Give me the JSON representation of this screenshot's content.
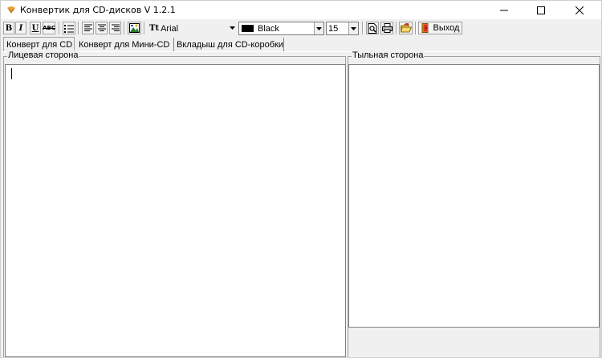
{
  "window": {
    "title": "Конвертик для CD-дисков V 1.2.1"
  },
  "toolbar": {
    "bold_label": "B",
    "italic_label": "I",
    "underline_label": "U",
    "strike_label": "ABC",
    "font_icon_label": "Tt",
    "font_name": "Arial",
    "color_name": "Black",
    "color_swatch": "#000000",
    "font_size": "15",
    "exit_label": "Выход"
  },
  "tabs": [
    {
      "label": "Конверт для CD",
      "active": true
    },
    {
      "label": "Конверт для Мини-CD",
      "active": false
    },
    {
      "label": "Вкладыш для CD-коробки",
      "active": false
    }
  ],
  "panels": {
    "front_label": "Лицевая сторона",
    "back_label": "Тыльная сторона"
  },
  "icons": [
    "app-icon",
    "minimize-icon",
    "maximize-icon",
    "close-icon",
    "bullet-list-icon",
    "align-left-icon",
    "align-center-icon",
    "align-right-icon",
    "picture-icon",
    "print-preview-icon",
    "printer-icon",
    "open-folder-icon",
    "door-exit-icon"
  ]
}
